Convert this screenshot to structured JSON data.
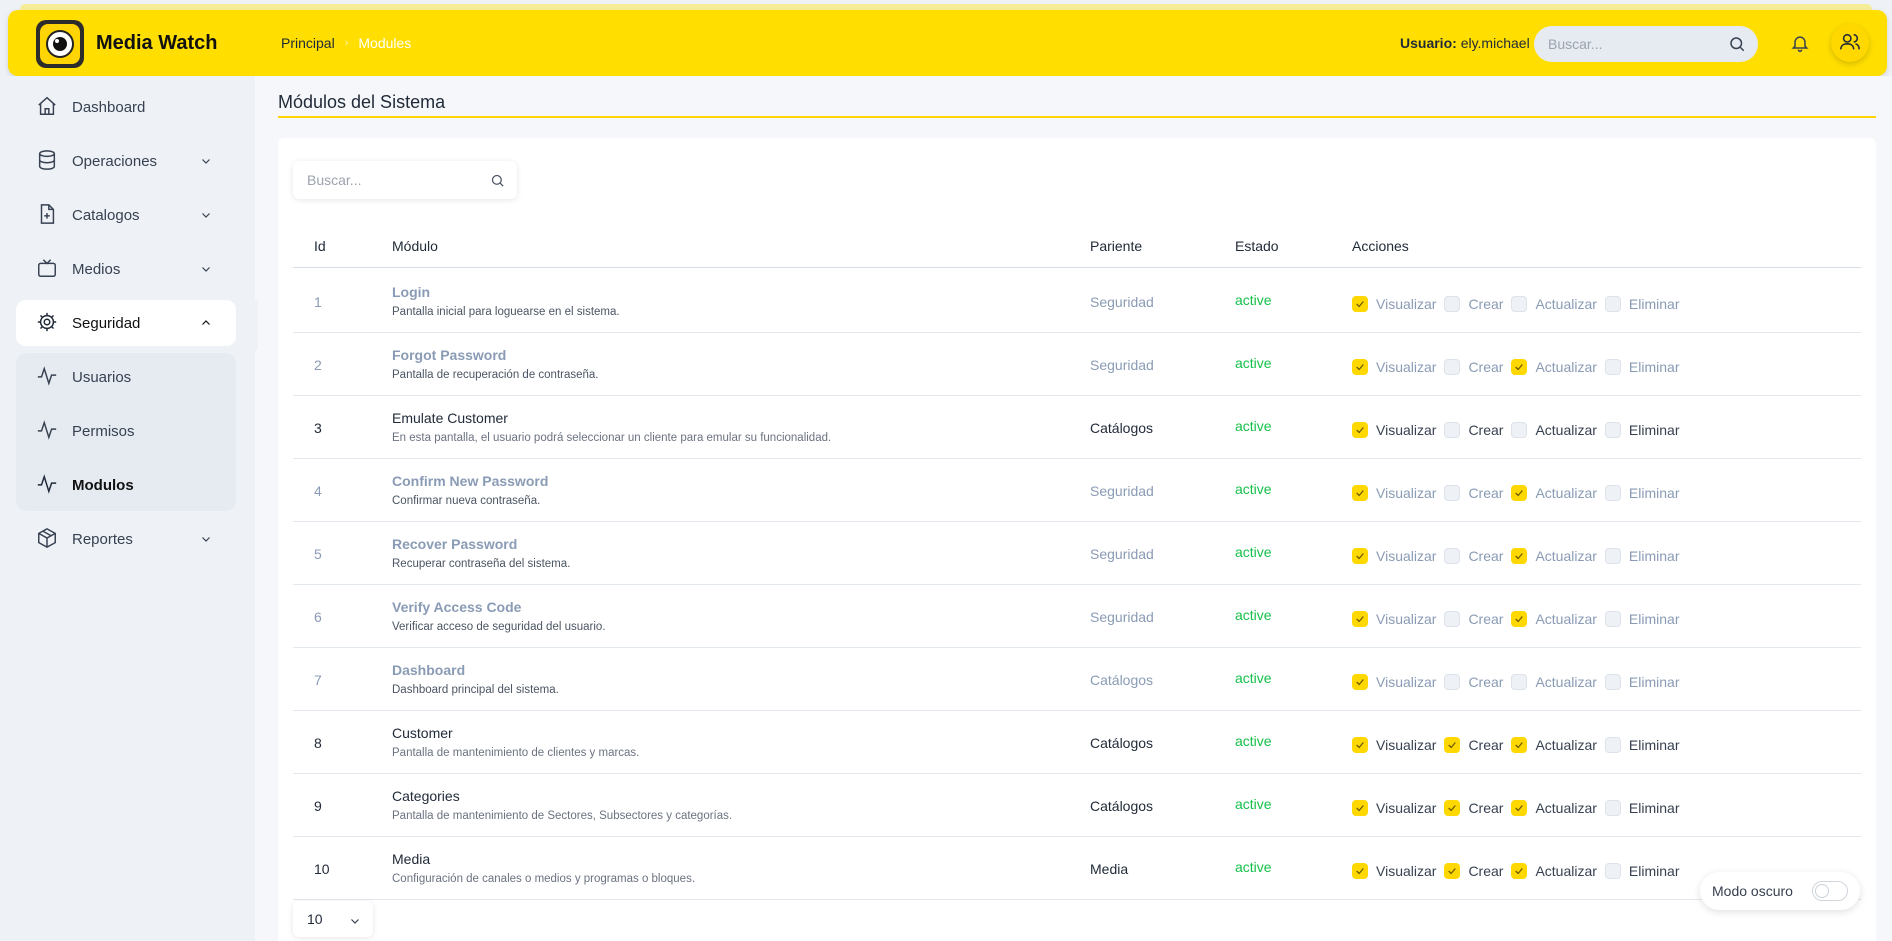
{
  "header": {
    "brand": "Media Watch",
    "breadcrumb": [
      "Principal",
      "Modules"
    ],
    "user_label": "Usuario:",
    "user_name": "ely.michael",
    "search_placeholder": "Buscar..."
  },
  "sidebar": {
    "items": [
      {
        "label": "Dashboard",
        "icon": "home-icon"
      },
      {
        "label": "Operaciones",
        "icon": "database-icon"
      },
      {
        "label": "Catalogos",
        "icon": "file-plus-icon"
      },
      {
        "label": "Medios",
        "icon": "tv-icon"
      },
      {
        "label": "Seguridad",
        "icon": "gear-icon"
      },
      {
        "label": "Reportes",
        "icon": "box-icon"
      }
    ],
    "subitems": [
      {
        "label": "Usuarios",
        "icon": "activity-icon"
      },
      {
        "label": "Permisos",
        "icon": "activity-icon"
      },
      {
        "label": "Modulos",
        "icon": "activity-icon"
      }
    ]
  },
  "main": {
    "title": "Módulos del Sistema",
    "search_placeholder": "Buscar...",
    "columns": [
      "Id",
      "Módulo",
      "Pariente",
      "Estado",
      "Acciones"
    ],
    "action_labels": [
      "Visualizar",
      "Crear",
      "Actualizar",
      "Eliminar"
    ],
    "rows": [
      {
        "id": "1",
        "name": "Login",
        "desc": "Pantalla inicial para loguearse en el sistema.",
        "parent": "Seguridad",
        "status": "active",
        "perms": [
          true,
          false,
          false,
          false
        ]
      },
      {
        "id": "2",
        "name": "Forgot Password",
        "desc": "Pantalla de recuperación de contraseña.",
        "parent": "Seguridad",
        "status": "active",
        "perms": [
          true,
          false,
          true,
          false
        ]
      },
      {
        "id": "3",
        "name": "Emulate Customer",
        "desc": "En esta pantalla, el usuario podrá seleccionar un cliente para emular su funcionalidad.",
        "parent": "Catálogos",
        "status": "active",
        "perms": [
          true,
          false,
          false,
          false
        ]
      },
      {
        "id": "4",
        "name": "Confirm New Password",
        "desc": "Confirmar nueva contraseña.",
        "parent": "Seguridad",
        "status": "active",
        "perms": [
          true,
          false,
          true,
          false
        ]
      },
      {
        "id": "5",
        "name": "Recover Password",
        "desc": "Recuperar contraseña del sistema.",
        "parent": "Seguridad",
        "status": "active",
        "perms": [
          true,
          false,
          true,
          false
        ]
      },
      {
        "id": "6",
        "name": "Verify Access Code",
        "desc": "Verificar acceso de seguridad del usuario.",
        "parent": "Seguridad",
        "status": "active",
        "perms": [
          true,
          false,
          true,
          false
        ]
      },
      {
        "id": "7",
        "name": "Dashboard",
        "desc": "Dashboard principal del sistema.",
        "parent": "Catálogos",
        "status": "active",
        "perms": [
          true,
          false,
          false,
          false
        ]
      },
      {
        "id": "8",
        "name": "Customer",
        "desc": "Pantalla de mantenimiento de clientes y marcas.",
        "parent": "Catálogos",
        "status": "active",
        "perms": [
          true,
          true,
          true,
          false
        ]
      },
      {
        "id": "9",
        "name": "Categories",
        "desc": "Pantalla de mantenimiento de Sectores, Subsectores y categorías.",
        "parent": "Catálogos",
        "status": "active",
        "perms": [
          true,
          true,
          true,
          false
        ]
      },
      {
        "id": "10",
        "name": "Media",
        "desc": "Configuración de canales o medios y programas o bloques.",
        "parent": "Media",
        "status": "active",
        "perms": [
          true,
          true,
          true,
          false
        ]
      }
    ],
    "row_style": [
      "muted",
      "muted",
      "dark",
      "muted",
      "muted",
      "muted",
      "muted",
      "dark",
      "dark",
      "dark"
    ],
    "page_size": "10",
    "dark_mode_label": "Modo oscuro"
  },
  "colors": {
    "accent": "#ffde00",
    "status_active": "#16c04a"
  }
}
